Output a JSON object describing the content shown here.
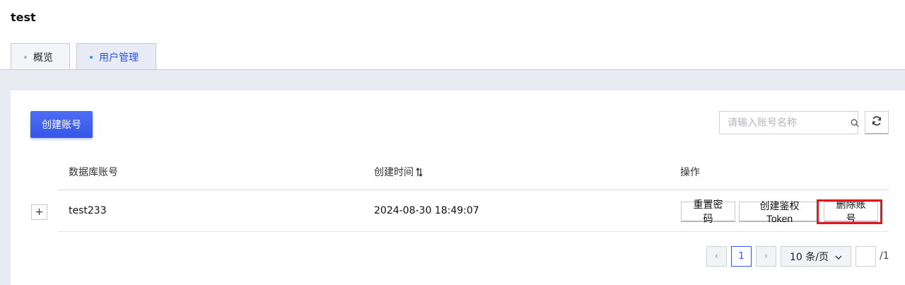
{
  "header": {
    "title": "test"
  },
  "tabs": [
    {
      "label": "概览",
      "active": false
    },
    {
      "label": "用户管理",
      "active": true
    }
  ],
  "toolbar": {
    "create_label": "创建账号",
    "search_placeholder": "请输入账号名称"
  },
  "table": {
    "columns": [
      "数据库账号",
      "创建时间",
      "操作"
    ],
    "rows": [
      {
        "account": "test233",
        "created_at": "2024-08-30 18:49:07",
        "actions": [
          "重置密码",
          "创建鉴权Token",
          "删除账号"
        ]
      }
    ],
    "expand_label": "+"
  },
  "pagination": {
    "prev": "‹",
    "current_page": "1",
    "next": "›",
    "page_size": "10 条/页",
    "total_pages": "/1"
  },
  "colors": {
    "accent": "#3656e8",
    "highlight": "#e6151b"
  }
}
